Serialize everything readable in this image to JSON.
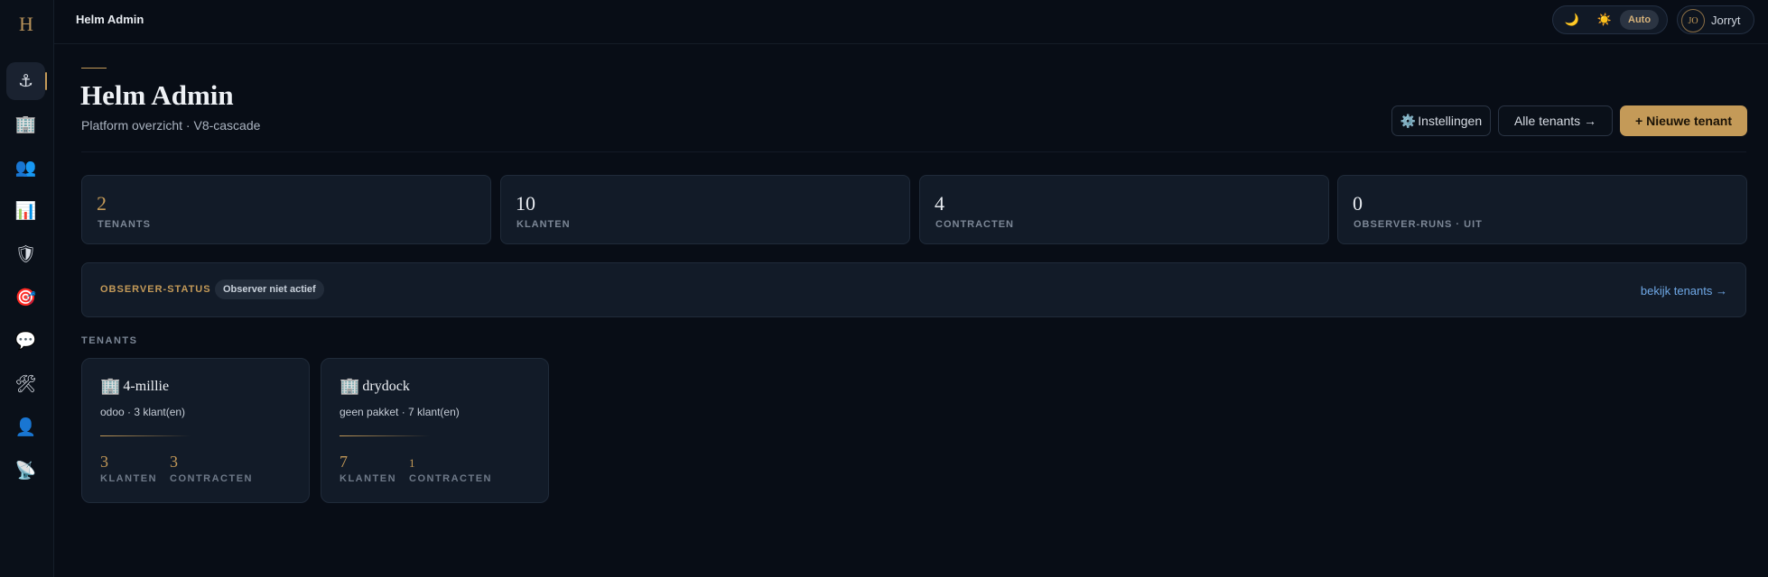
{
  "sidebar": {
    "logo": "H",
    "items": [
      {
        "icon": "anchor-icon",
        "glyph": "⚓",
        "active": true
      },
      {
        "icon": "office-building-icon",
        "glyph": "🏢"
      },
      {
        "icon": "users-icon",
        "glyph": "👥"
      },
      {
        "icon": "bar-chart-icon",
        "glyph": "📊"
      },
      {
        "icon": "shield-icon",
        "glyph": "🛡"
      },
      {
        "icon": "target-icon",
        "glyph": "🎯"
      },
      {
        "icon": "speech-bubble-icon",
        "glyph": "💬"
      },
      {
        "icon": "tools-icon",
        "glyph": "🛠"
      },
      {
        "icon": "user-icon",
        "glyph": "👤"
      },
      {
        "icon": "satellite-icon",
        "glyph": "📡"
      }
    ]
  },
  "topbar": {
    "title": "Helm Admin",
    "theme": {
      "moon": "🌙",
      "sun": "☀️",
      "auto": "Auto"
    },
    "user": {
      "initials": "JO",
      "name": "Jorryt"
    }
  },
  "header": {
    "title": "Helm Admin",
    "subtitle": "Platform overzicht · V8-cascade",
    "settings_icon": "⚙️",
    "settings_label": "Instellingen",
    "all_tenants_label": "Alle tenants →",
    "new_tenant_label": "+ Nieuwe tenant"
  },
  "stats": [
    {
      "value": "2",
      "label": "TENANTS"
    },
    {
      "value": "10",
      "label": "KLANTEN"
    },
    {
      "value": "4",
      "label": "CONTRACTEN"
    },
    {
      "value": "0",
      "label": "OBSERVER-RUNS · UIT"
    }
  ],
  "observer": {
    "label": "OBSERVER-STATUS",
    "badge": "Observer niet actief",
    "link": "bekijk tenants →"
  },
  "tenants_section": {
    "title": "TENANTS",
    "items": [
      {
        "icon": "🏢",
        "name": "4-millie",
        "meta": "odoo · 3 klant(en)",
        "klanten": "3",
        "contracten": "3",
        "klanten_label": "KLANTEN",
        "contracten_label": "CONTRACTEN"
      },
      {
        "icon": "🏢",
        "name": "drydock",
        "meta": "geen pakket · 7 klant(en)",
        "klanten": "7",
        "contracten": "1",
        "klanten_label": "KLANTEN",
        "contracten_label": "CONTRACTEN"
      }
    ]
  },
  "colors": {
    "accent": "#c49a58",
    "background": "#080d16",
    "card": "#121b28",
    "link": "#6fa8e6"
  }
}
